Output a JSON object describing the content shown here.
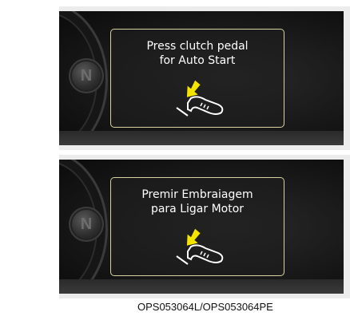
{
  "panels": [
    {
      "gear_letter": "N",
      "message_line1": "Press clutch pedal",
      "message_line2": "for Auto Start",
      "icon": "clutch-pedal-press-icon"
    },
    {
      "gear_letter": "N",
      "message_line1": "Premir Embraiagem",
      "message_line2": "para Ligar Motor",
      "icon": "clutch-pedal-press-icon"
    }
  ],
  "caption": "OPS053064L/OPS053064PE",
  "colors": {
    "arrow": "#f5e400",
    "frame": "#d9d2a0",
    "text": "#ffffff",
    "screen": "#141414"
  }
}
